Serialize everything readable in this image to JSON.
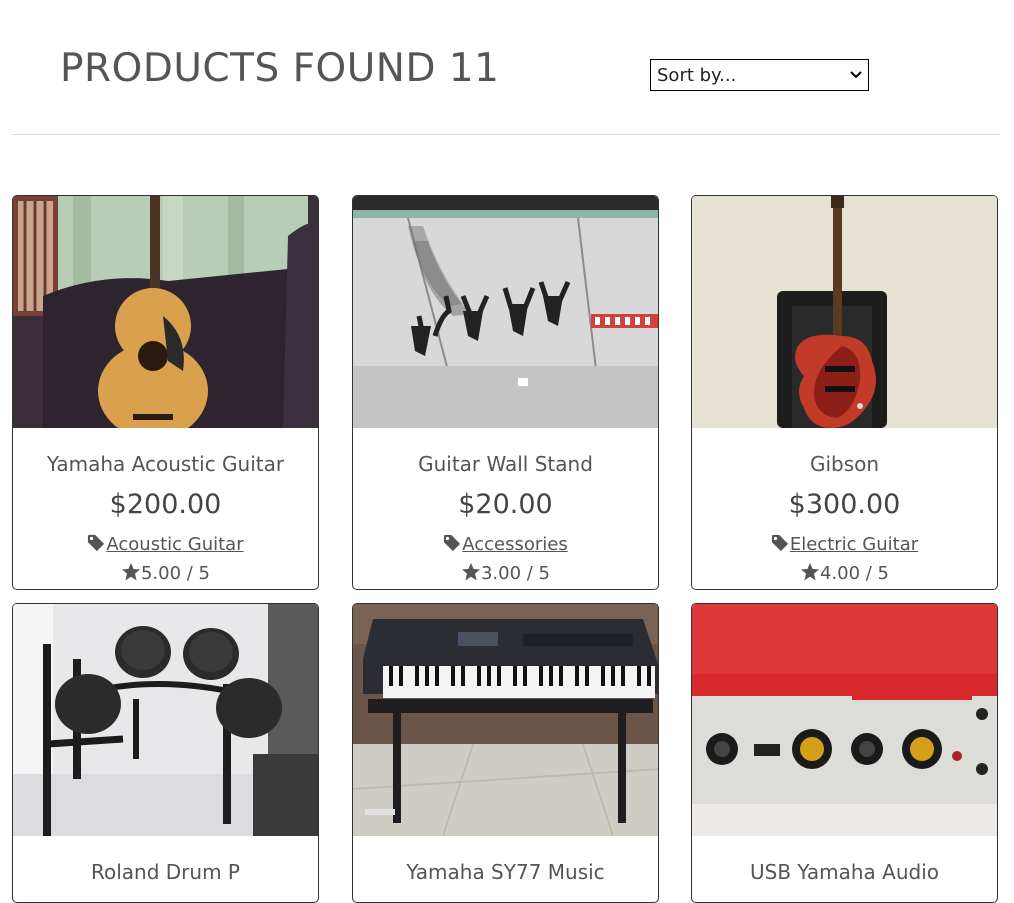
{
  "header": {
    "title": "PRODUCTS FOUND 11",
    "sort_select": {
      "selected": "Sort by..."
    }
  },
  "products": [
    {
      "name": "Yamaha Acoustic Guitar",
      "price": "$200.00",
      "category": "Acoustic Guitar",
      "rating": "5.00 / 5"
    },
    {
      "name": "Guitar Wall Stand",
      "price": "$20.00",
      "category": "Accessories",
      "rating": "3.00 / 5"
    },
    {
      "name": "Gibson",
      "price": "$300.00",
      "category": "Electric Guitar",
      "rating": "4.00 / 5"
    },
    {
      "name": "Roland Drum P",
      "price": "",
      "category": "",
      "rating": ""
    },
    {
      "name": "Yamaha SY77 Music",
      "price": "",
      "category": "",
      "rating": ""
    },
    {
      "name": "USB Yamaha Audio",
      "price": "",
      "category": "",
      "rating": ""
    }
  ],
  "icons": {
    "category": "tag-icon",
    "rating": "star-icon",
    "sort": "chevron-down-icon"
  },
  "colors": {
    "text": "#555555",
    "card_border": "#333333",
    "divider": "#d9d9d9",
    "interface_red": "#d8282c"
  }
}
